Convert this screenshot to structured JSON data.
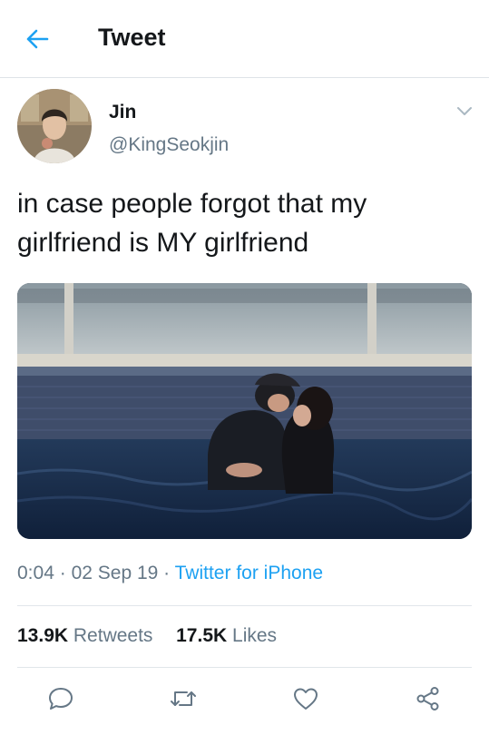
{
  "header": {
    "title": "Tweet",
    "back_icon": "arrow-left-icon"
  },
  "accent_color": "#1da1f2",
  "author": {
    "name": "Jin",
    "handle": "@KingSeokjin"
  },
  "tweet": {
    "text_line1": "in case people forgot that my",
    "text_line2": "girlfriend is MY girlfriend",
    "time": "0:04",
    "date": "02 Sep 19",
    "sep": "·",
    "source": "Twitter for iPhone"
  },
  "stats": {
    "retweets_count": "13.9K",
    "retweets_label": "Retweets",
    "likes_count": "17.5K",
    "likes_label": "Likes"
  },
  "actions": [
    "reply-icon",
    "retweet-icon",
    "like-icon",
    "share-icon"
  ]
}
